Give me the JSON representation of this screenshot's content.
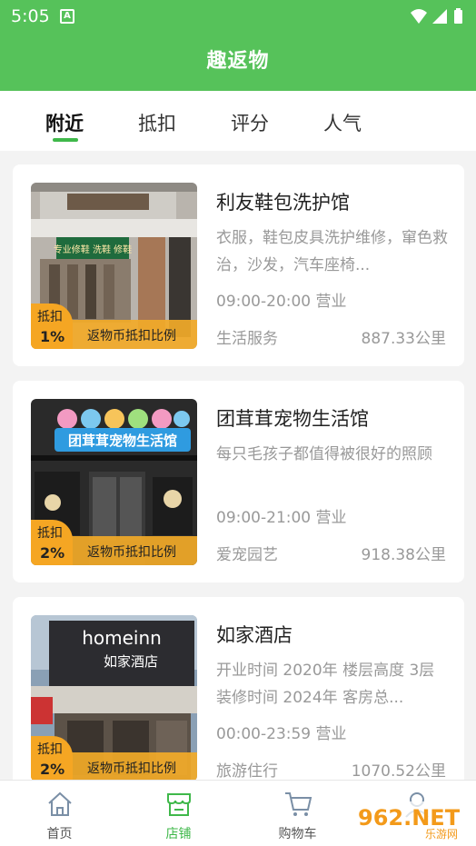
{
  "status_bar": {
    "time": "5:05",
    "notif_letter": "A"
  },
  "app_bar": {
    "title": "趣返物"
  },
  "tabs": [
    {
      "label": "附近",
      "active": true
    },
    {
      "label": "抵扣",
      "active": false
    },
    {
      "label": "评分",
      "active": false
    },
    {
      "label": "人气",
      "active": false
    }
  ],
  "shops": [
    {
      "name": "利友鞋包洗护馆",
      "description": "衣服，鞋包皮具洗护维修，窜色救治，沙发，汽车座椅...",
      "hours": "09:00-20:00 营业",
      "category": "生活服务",
      "distance": "887.33公里",
      "deduct_label": "抵扣",
      "deduct_pct": "1%",
      "deduct_text": "返物币抵扣比例",
      "sign_text": "专业修鞋 洗鞋 修鞋"
    },
    {
      "name": "团茸茸宠物生活馆",
      "description": "每只毛孩子都值得被很好的照顾",
      "hours": "09:00-21:00 营业",
      "category": "爱宠园艺",
      "distance": "918.38公里",
      "deduct_label": "抵扣",
      "deduct_pct": "2%",
      "deduct_text": "返物币抵扣比例",
      "sign_text": "团茸茸宠物生活馆"
    },
    {
      "name": "如家酒店",
      "description": "开业时间 2020年 楼层高度 3层 装修时间 2024年 客房总...",
      "hours": "00:00-23:59 营业",
      "category": "旅游住行",
      "distance": "1070.52公里",
      "deduct_label": "抵扣",
      "deduct_pct": "2%",
      "deduct_text": "返物币抵扣比例",
      "sign_text_en": "homeinn",
      "sign_text": "如家酒店"
    }
  ],
  "bottom_nav": [
    {
      "label": "首页",
      "icon": "home-icon",
      "active": false
    },
    {
      "label": "店铺",
      "icon": "shop-icon",
      "active": true
    },
    {
      "label": "购物车",
      "icon": "cart-icon",
      "active": false
    },
    {
      "label": "",
      "icon": "user-icon",
      "active": false
    }
  ],
  "watermark": {
    "brand": "962.NET",
    "sub": "乐游网"
  },
  "colors": {
    "primary": "#56c25a",
    "accent": "#3fb84a",
    "badge": "#f5a623"
  }
}
